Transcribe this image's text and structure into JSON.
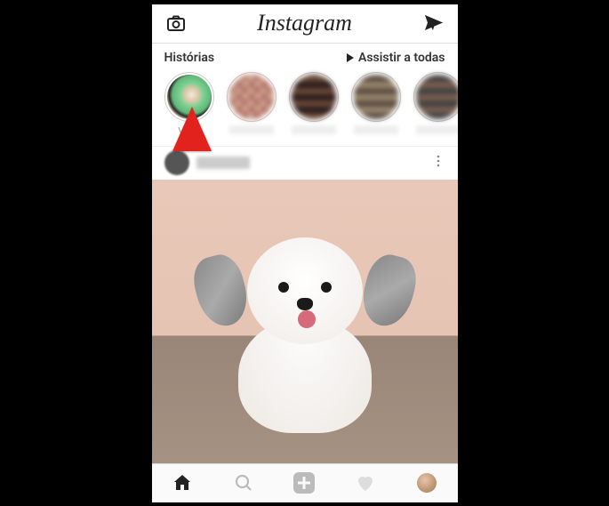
{
  "header": {
    "app_name": "Instagram"
  },
  "stories": {
    "title": "Histórias",
    "watch_all": "Assistir a todas",
    "your_story_label": "Você"
  },
  "nav": {
    "home": "home",
    "search": "search",
    "add": "add",
    "activity": "activity",
    "profile": "profile"
  }
}
